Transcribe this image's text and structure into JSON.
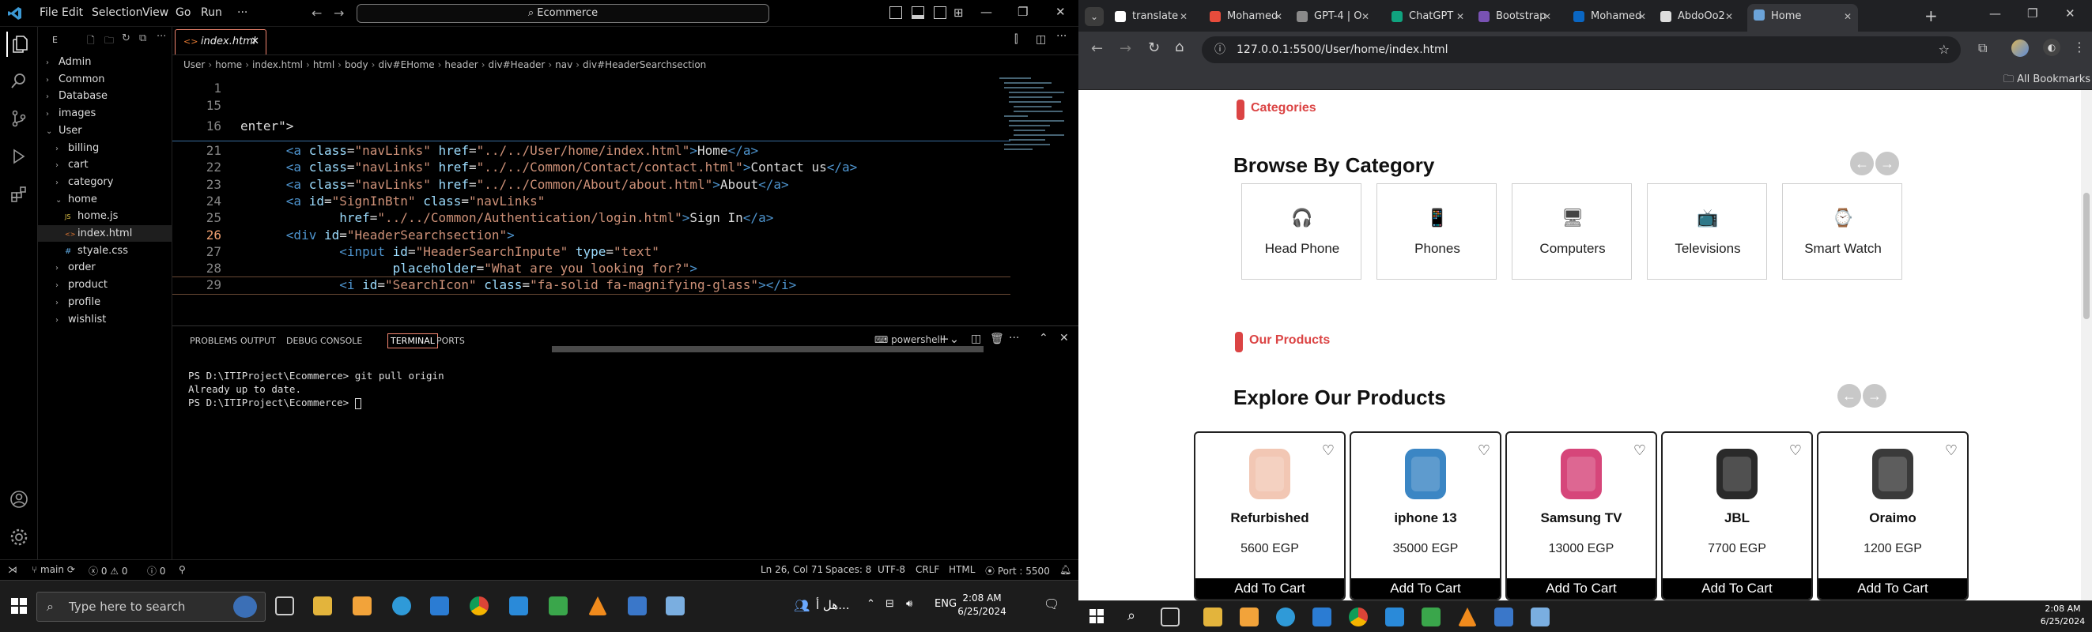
{
  "vscode": {
    "menu": [
      "File",
      "Edit",
      "Selection",
      "View",
      "Go",
      "Run",
      "···"
    ],
    "command_center": "Ecommerce",
    "tab": {
      "label": "index.html"
    },
    "breadcrumb": [
      "User",
      "home",
      "index.html",
      "html",
      "body",
      "div#EHome",
      "header",
      "div#Header",
      "nav",
      "div#HeaderSearchsection"
    ],
    "explorer": {
      "header": "E",
      "tree": [
        {
          "label": "Admin",
          "type": "folder",
          "open": false,
          "indent": 0
        },
        {
          "label": "Common",
          "type": "folder",
          "open": false,
          "indent": 0
        },
        {
          "label": "Database",
          "type": "folder",
          "open": false,
          "indent": 0
        },
        {
          "label": "images",
          "type": "folder",
          "open": false,
          "indent": 0
        },
        {
          "label": "User",
          "type": "folder",
          "open": true,
          "indent": 0
        },
        {
          "label": "billing",
          "type": "folder",
          "open": false,
          "indent": 1
        },
        {
          "label": "cart",
          "type": "folder",
          "open": false,
          "indent": 1
        },
        {
          "label": "category",
          "type": "folder",
          "open": false,
          "indent": 1
        },
        {
          "label": "home",
          "type": "folder",
          "open": true,
          "indent": 1
        },
        {
          "label": "home.js",
          "type": "js",
          "open": false,
          "indent": 2
        },
        {
          "label": "index.html",
          "type": "html",
          "open": false,
          "indent": 2
        },
        {
          "label": "styale.css",
          "type": "css",
          "open": false,
          "indent": 2
        },
        {
          "label": "order",
          "type": "folder",
          "open": false,
          "indent": 1
        },
        {
          "label": "product",
          "type": "folder",
          "open": false,
          "indent": 1
        },
        {
          "label": "profile",
          "type": "folder",
          "open": false,
          "indent": 1
        },
        {
          "label": "wishlist",
          "type": "folder",
          "open": false,
          "indent": 1
        }
      ]
    },
    "sticky_lines": [
      {
        "num": "1",
        "text": ""
      },
      {
        "num": "15",
        "text": ""
      },
      {
        "num": "16",
        "text": "enter\">"
      }
    ],
    "code_lines": [
      {
        "num": "21",
        "indent": "      ",
        "parts": [
          [
            "tg",
            "<a "
          ],
          [
            "at",
            "class"
          ],
          [
            "",
            "="
          ],
          [
            "st",
            "\"navLinks\""
          ],
          [
            "at",
            " href"
          ],
          [
            "",
            "="
          ],
          [
            "st",
            "\"../../User/home/index.html\""
          ],
          [
            "tg",
            ">"
          ],
          [
            "",
            "Home"
          ],
          [
            "tg",
            "</a>"
          ]
        ]
      },
      {
        "num": "22",
        "indent": "      ",
        "parts": [
          [
            "tg",
            "<a "
          ],
          [
            "at",
            "class"
          ],
          [
            "",
            "="
          ],
          [
            "st",
            "\"navLinks\""
          ],
          [
            "at",
            " href"
          ],
          [
            "",
            "="
          ],
          [
            "st",
            "\"../../Common/Contact/contact.html\""
          ],
          [
            "tg",
            ">"
          ],
          [
            "",
            "Contact us"
          ],
          [
            "tg",
            "</a>"
          ]
        ]
      },
      {
        "num": "23",
        "indent": "      ",
        "parts": [
          [
            "tg",
            "<a "
          ],
          [
            "at",
            "class"
          ],
          [
            "",
            "="
          ],
          [
            "st",
            "\"navLinks\""
          ],
          [
            "at",
            " href"
          ],
          [
            "",
            "="
          ],
          [
            "st",
            "\"../../Common/About/about.html\""
          ],
          [
            "tg",
            ">"
          ],
          [
            "",
            "About"
          ],
          [
            "tg",
            "</a>"
          ]
        ]
      },
      {
        "num": "24",
        "indent": "      ",
        "parts": [
          [
            "tg",
            "<a "
          ],
          [
            "at",
            "id"
          ],
          [
            "",
            "="
          ],
          [
            "st",
            "\"SignInBtn\""
          ],
          [
            "at",
            " class"
          ],
          [
            "",
            "="
          ],
          [
            "st",
            "\"navLinks\""
          ]
        ]
      },
      {
        "num": "25",
        "indent": "             ",
        "parts": [
          [
            "at",
            "href"
          ],
          [
            "",
            "="
          ],
          [
            "st",
            "\"../../Common/Authentication/login.html\""
          ],
          [
            "tg",
            ">"
          ],
          [
            "",
            "Sign In"
          ],
          [
            "tg",
            "</a>"
          ]
        ]
      },
      {
        "num": "26",
        "indent": "      ",
        "parts": [
          [
            "tg",
            "<div "
          ],
          [
            "at",
            "id"
          ],
          [
            "",
            "="
          ],
          [
            "st",
            "\"HeaderSearchsection\""
          ],
          [
            "tg",
            ">"
          ]
        ]
      },
      {
        "num": "27",
        "indent": "             ",
        "parts": [
          [
            "tg",
            "<input "
          ],
          [
            "at",
            "id"
          ],
          [
            "",
            "="
          ],
          [
            "st",
            "\"HeaderSearchInpute\""
          ],
          [
            "at",
            " type"
          ],
          [
            "",
            "="
          ],
          [
            "st",
            "\"text\""
          ]
        ]
      },
      {
        "num": "28",
        "indent": "                    ",
        "parts": [
          [
            "at",
            "placeholder"
          ],
          [
            "",
            "="
          ],
          [
            "st",
            "\"What are you looking for?\""
          ],
          [
            "tg",
            ">"
          ]
        ]
      },
      {
        "num": "29",
        "indent": "             ",
        "parts": [
          [
            "tg",
            "<i "
          ],
          [
            "at",
            "id"
          ],
          [
            "",
            "="
          ],
          [
            "st",
            "\"SearchIcon\""
          ],
          [
            "at",
            " class"
          ],
          [
            "",
            "="
          ],
          [
            "st",
            "\"fa-solid fa-magnifying-glass\""
          ],
          [
            "tg",
            "></i>"
          ]
        ]
      }
    ],
    "panel_tabs": [
      "PROBLEMS",
      "OUTPUT",
      "DEBUG CONSOLE",
      "TERMINAL",
      "PORTS"
    ],
    "shell": "powershell",
    "terminal": [
      "PS D:\\ITIProject\\Ecommerce> git pull origin",
      "Already up to date.",
      "PS D:\\ITIProject\\Ecommerce> "
    ],
    "status": {
      "branch": "main",
      "errors": "0",
      "warnings": "0",
      "info": "0",
      "position": "Ln 26, Col 71",
      "spaces": "Spaces: 8",
      "encoding": "UTF-8",
      "eol": "CRLF",
      "language": "HTML",
      "port": "Port : 5500"
    }
  },
  "chrome": {
    "tabs": [
      "translate",
      "Mohamed",
      "GPT-4 | O",
      "ChatGPT",
      "Bootstrap",
      "Mohamed",
      "AbdoOo2",
      "Home"
    ],
    "url": "127.0.0.1:5500/User/home/index.html",
    "bookmarks_label": "All Bookmarks"
  },
  "site": {
    "categories_label": "Categories",
    "browse_heading": "Browse By Category",
    "categories": [
      {
        "label": "Head Phone",
        "icon": "headphone-icon",
        "glyph": "🎧"
      },
      {
        "label": "Phones",
        "icon": "phone-icon",
        "glyph": "📱"
      },
      {
        "label": "Computers",
        "icon": "computer-icon",
        "glyph": "🖥"
      },
      {
        "label": "Televisions",
        "icon": "television-icon",
        "glyph": "📺"
      },
      {
        "label": "Smart Watch",
        "icon": "smartwatch-icon",
        "glyph": "⌚"
      }
    ],
    "products_label": "Our Products",
    "explore_heading": "Explore Our Products",
    "products": [
      {
        "name": "Refurbished",
        "price": "5600 EGP",
        "button": "Add To Cart",
        "color": "#f2c7b4"
      },
      {
        "name": "iphone 13",
        "price": "35000 EGP",
        "button": "Add To Cart",
        "color": "#3b86c4"
      },
      {
        "name": "Samsung TV",
        "price": "13000 EGP",
        "button": "Add To Cart",
        "color": "#d6467a"
      },
      {
        "name": "JBL",
        "price": "7700 EGP",
        "button": "Add To Cart",
        "color": "#2a2a2a"
      },
      {
        "name": "Oraimo",
        "price": "1200 EGP",
        "button": "Add To Cart",
        "color": "#3a3a3a"
      }
    ]
  },
  "taskbar": {
    "search_placeholder": "Type here to search",
    "lang": "ENG",
    "time": "2:08 AM",
    "date": "6/25/2024",
    "arabic": "هل أ..."
  }
}
